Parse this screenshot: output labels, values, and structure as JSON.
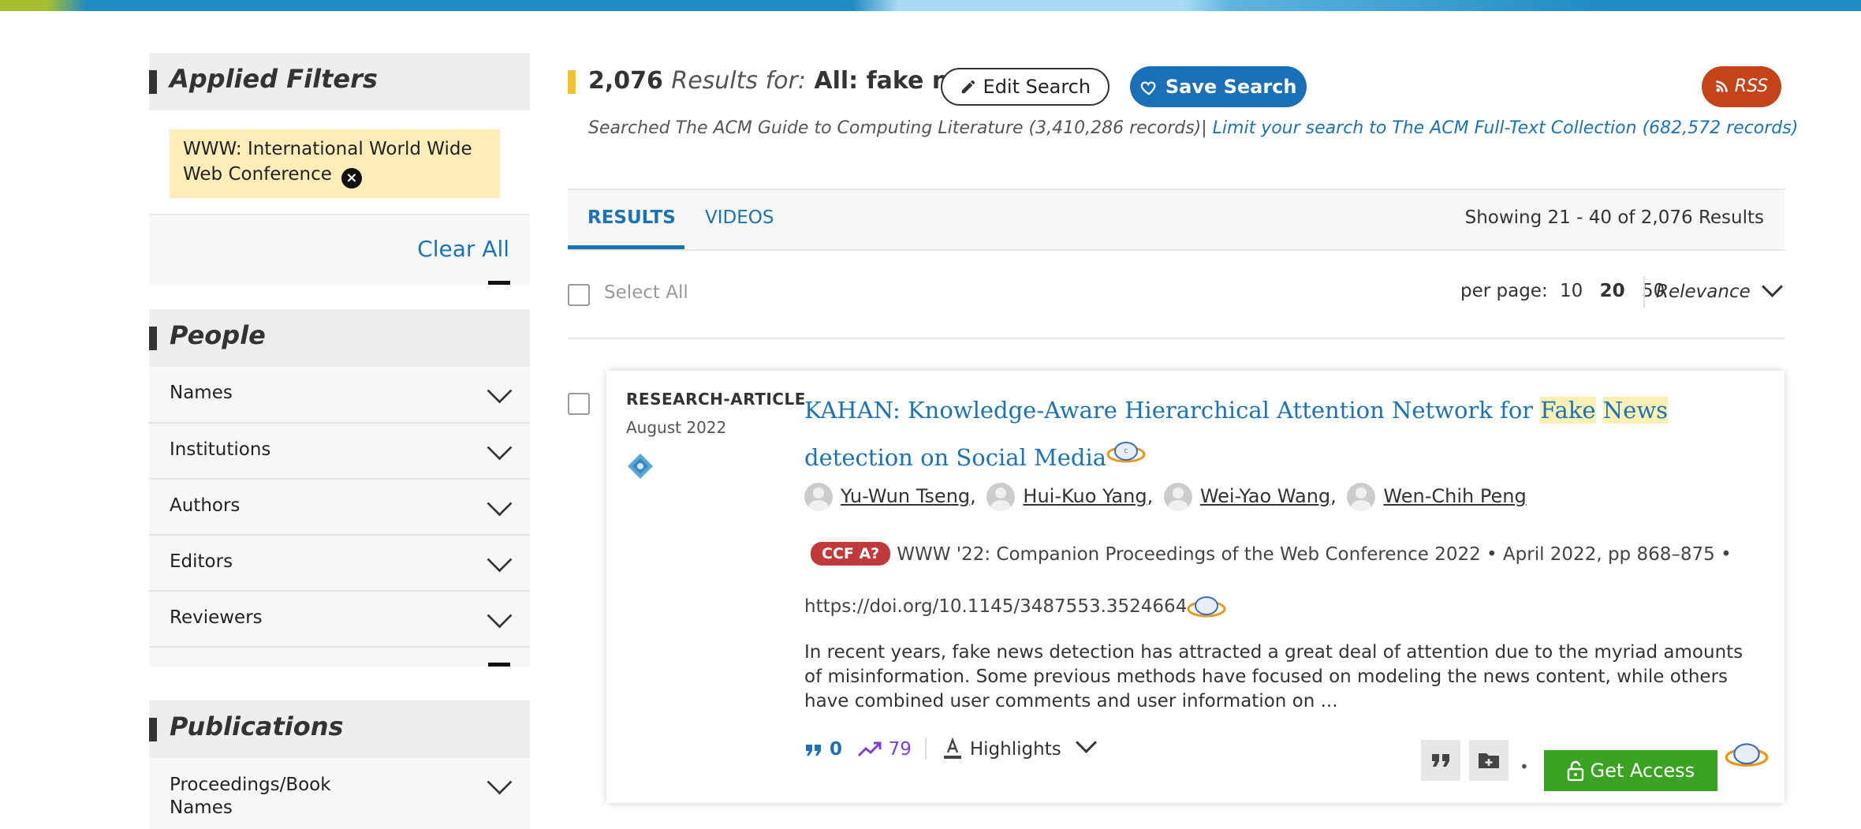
{
  "sidebar": {
    "applied_filters": {
      "title": "Applied Filters",
      "chip_label": "WWW: International World Wide Web Conference",
      "clear_all": "Clear All"
    },
    "people": {
      "title": "People",
      "items": [
        {
          "label": "Names"
        },
        {
          "label": "Institutions"
        },
        {
          "label": "Authors"
        },
        {
          "label": "Editors"
        },
        {
          "label": "Reviewers"
        }
      ]
    },
    "publications": {
      "title": "Publications",
      "items": [
        {
          "label": "Proceedings/Book Names"
        }
      ]
    }
  },
  "results_header": {
    "count": "2,076",
    "results_for": "Results for:",
    "query": "All: fake news",
    "edit_search": "Edit Search",
    "save_search": "Save Search",
    "rss": "RSS",
    "searched_text": "Searched The ACM Guide to Computing Literature (3,410,286 records)",
    "limit_link": "Limit your search to The ACM Full-Text Collection (682,572 records)"
  },
  "tabs": {
    "items": [
      {
        "label": "RESULTS",
        "active": true
      },
      {
        "label": "VIDEOS",
        "active": false
      }
    ],
    "showing": "Showing 21 - 40  of 2,076 Results"
  },
  "controls": {
    "select_all": "Select All",
    "per_page_label": "per page:",
    "per_page_options": [
      "10",
      "20",
      "50"
    ],
    "per_page_selected": "20",
    "sort": "Relevance"
  },
  "result": {
    "type": "RESEARCH-ARTICLE",
    "date": "August 2022",
    "title_pre": "KAHAN: Knowledge-Aware Hierarchical Attention Network for ",
    "title_hl1": "Fake",
    "title_hl2": "News",
    "title_post": " detection on Social Media",
    "authors": [
      "Yu-Wun Tseng",
      "Hui-Kuo Yang",
      "Wei-Yao Wang",
      "Wen-Chih Peng"
    ],
    "ccf": "CCF A?",
    "venue": "WWW '22: Companion Proceedings of the Web Conference 2022 • April 2022, pp 868–875 • https://doi.org/10.1145/3487553.3524664",
    "abstract": "In recent years, fake news detection has attracted a great deal of attention due to the myriad amounts of misinformation. Some previous methods have focused on modeling the news content, while others have combined user comments and user information on ...",
    "citations": "0",
    "downloads": "79",
    "highlights": "Highlights",
    "get_access": "Get Access"
  },
  "colors": {
    "link": "#1a73b6",
    "save_button": "#1a6fb9",
    "rss_button": "#c44318",
    "get_access": "#3aa321",
    "ccf_badge": "#c0393b",
    "highlight": "#fcf0b5",
    "filter_chip": "#fdedb8"
  }
}
